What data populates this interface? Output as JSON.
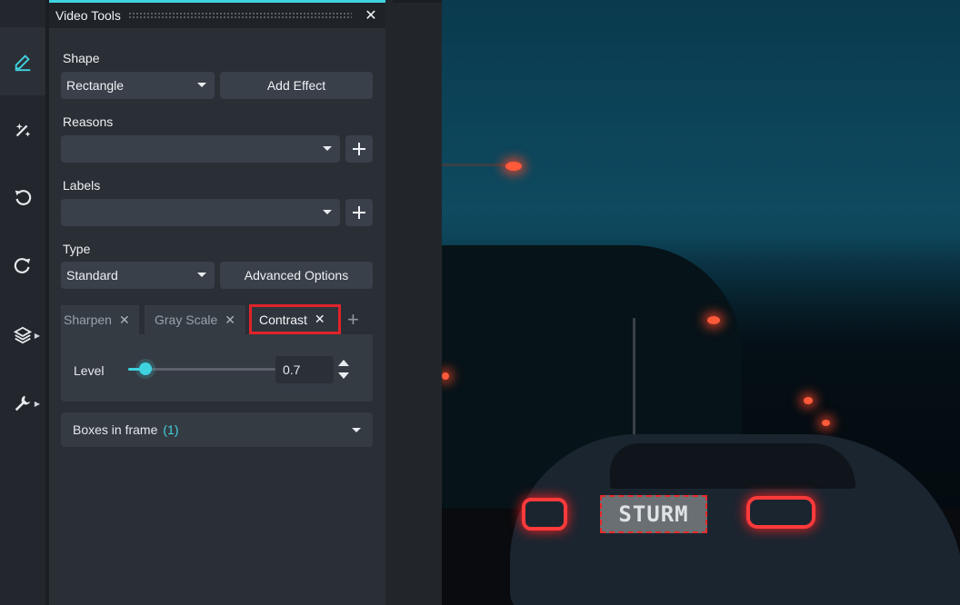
{
  "panel": {
    "title": "Video Tools",
    "close_icon": "close-icon"
  },
  "rail": {
    "items": [
      "pencil-icon",
      "magic-wand-icon",
      "undo-icon",
      "redo-icon",
      "layers-icon",
      "wrench-icon"
    ],
    "active": "pencil-icon"
  },
  "shape": {
    "label": "Shape",
    "selected": "Rectangle",
    "add_effect_label": "Add Effect"
  },
  "reasons": {
    "label": "Reasons",
    "selected": ""
  },
  "labels": {
    "label": "Labels",
    "selected": ""
  },
  "type": {
    "label": "Type",
    "selected": "Standard",
    "advanced_label": "Advanced Options"
  },
  "effects": {
    "tabs": [
      {
        "label": "Sharpen"
      },
      {
        "label": "Gray Scale"
      },
      {
        "label": "Contrast"
      }
    ],
    "active_tab": "Contrast",
    "level_label": "Level",
    "level_value": "0.7",
    "level_fraction": 0.12
  },
  "boxes": {
    "label": "Boxes in frame",
    "count": "(1)"
  },
  "image": {
    "plate_text": "STURM",
    "colors": {
      "accent": "#3fd3e0",
      "highlight_red": "#e0222a"
    }
  }
}
